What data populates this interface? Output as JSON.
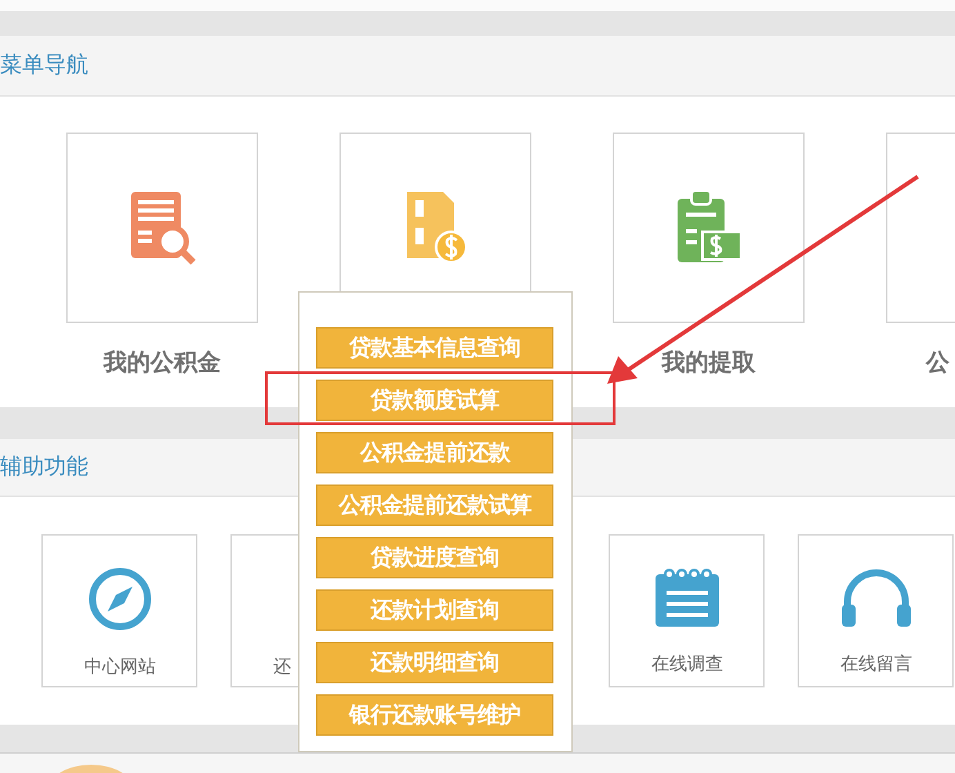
{
  "sections": [
    {
      "title": "菜单导航",
      "tiles": [
        {
          "kind": "labeled",
          "label": "我的公积金"
        },
        {
          "kind": "covered"
        },
        {
          "kind": "labeled",
          "label": "我的提取"
        },
        {
          "kind": "labeled",
          "label": "公"
        }
      ]
    },
    {
      "title": "辅助功能",
      "tiles": [
        {
          "kind": "labeled",
          "label": "中心网站"
        },
        {
          "kind": "labeled",
          "label": "还"
        },
        {
          "kind": "labeled",
          "label": "在线调查"
        },
        {
          "kind": "labeled",
          "label": "在线留言"
        }
      ]
    }
  ],
  "popup": {
    "items": [
      {
        "label": "贷款基本信息查询",
        "annotated": false
      },
      {
        "label": "贷款额度试算",
        "annotated": true
      },
      {
        "label": "公积金提前还款",
        "annotated": false
      },
      {
        "label": "公积金提前还款试算",
        "annotated": false
      },
      {
        "label": "贷款进度查询",
        "annotated": false
      },
      {
        "label": "还款计划查询",
        "annotated": false
      },
      {
        "label": "还款明细查询",
        "annotated": false
      },
      {
        "label": "银行还款账号维护",
        "annotated": false
      }
    ]
  }
}
